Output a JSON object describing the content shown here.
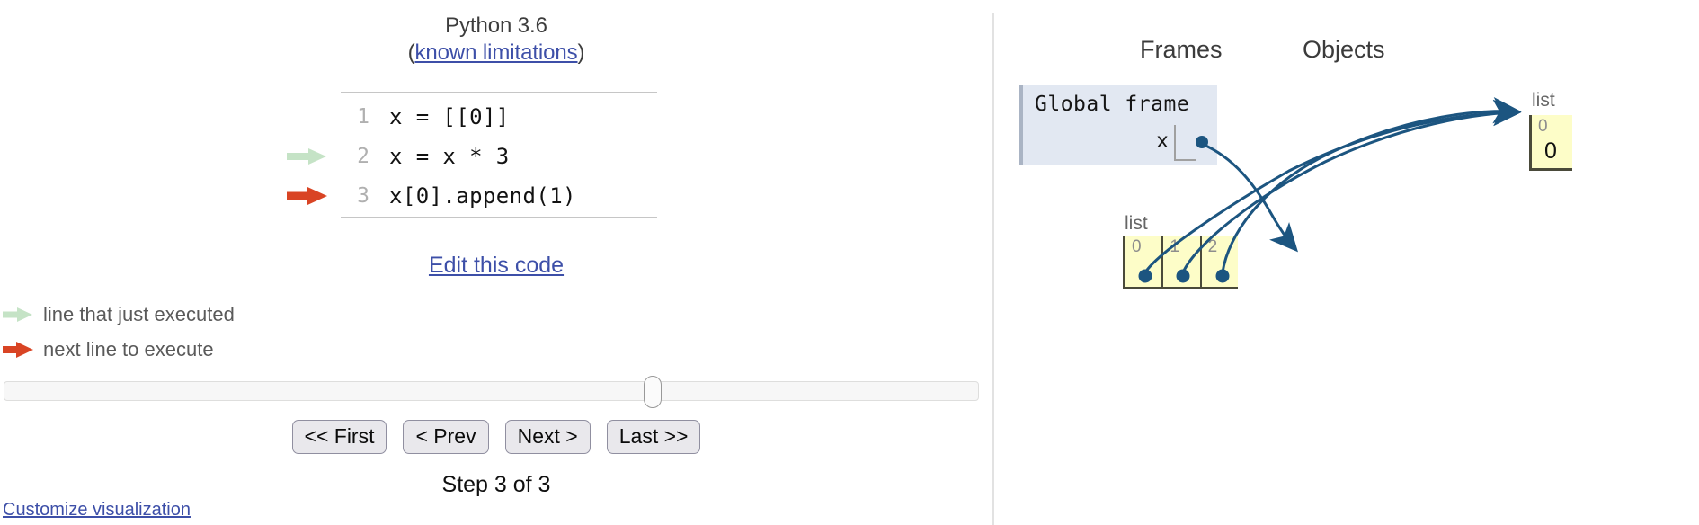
{
  "left": {
    "python_version": "Python 3.6",
    "limitations_prefix": "(",
    "limitations_link": "known limitations",
    "limitations_suffix": ")",
    "code_lines": [
      {
        "number": "1",
        "text": "x = [[0]]",
        "arrow": "none"
      },
      {
        "number": "2",
        "text": "x = x * 3",
        "arrow": "green"
      },
      {
        "number": "3",
        "text": "x[0].append(1)",
        "arrow": "red"
      }
    ],
    "edit_link": "Edit this code",
    "legend": [
      {
        "arrow": "green",
        "label": "line that just executed"
      },
      {
        "arrow": "red",
        "label": "next line to execute"
      }
    ],
    "buttons": [
      {
        "label": "<< First"
      },
      {
        "label": "< Prev"
      },
      {
        "label": "Next >"
      },
      {
        "label": "Last >>"
      }
    ],
    "step_text": "Step 3 of 3",
    "customize_link": "Customize visualization",
    "slider": {
      "value": 3,
      "min": 1,
      "max": 3,
      "percent": 66
    }
  },
  "right": {
    "frames_heading": "Frames",
    "objects_heading": "Objects",
    "global_frame": {
      "title": "Global frame",
      "variables": [
        {
          "name": "x"
        }
      ]
    },
    "objects": [
      {
        "id": "outer-list",
        "type_label": "list",
        "cells": [
          {
            "index": "0",
            "value": ""
          },
          {
            "index": "1",
            "value": ""
          },
          {
            "index": "2",
            "value": ""
          }
        ]
      },
      {
        "id": "inner-list",
        "type_label": "list",
        "cells": [
          {
            "index": "0",
            "value": "0"
          }
        ]
      }
    ]
  },
  "colors": {
    "green_arrow": "#c5e3c6",
    "red_arrow": "#d94424",
    "link": "#3d4fa8",
    "frame_bg": "#e2e8f2",
    "frame_border": "#aab4c4",
    "object_bg": "#fdfdc8",
    "object_border": "#4a4a3a",
    "pointer": "#1c5580",
    "divider": "#e2e2e2"
  }
}
